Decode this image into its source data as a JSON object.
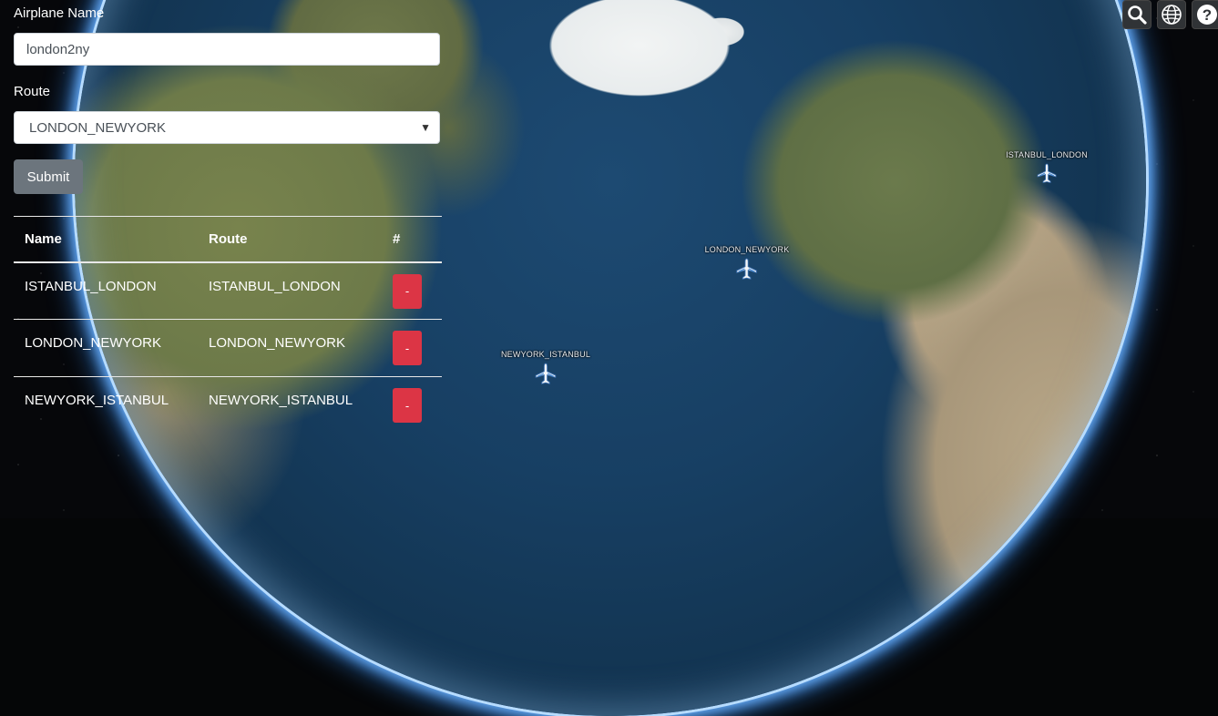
{
  "form": {
    "name_label": "Airplane Name",
    "name_value": "london2ny",
    "route_label": "Route",
    "route_selected": "LONDON_NEWYORK",
    "submit_label": "Submit"
  },
  "table": {
    "headers": [
      "Name",
      "Route",
      "#"
    ],
    "rows": [
      {
        "name": "ISTANBUL_LONDON",
        "route": "ISTANBUL_LONDON",
        "action": "-"
      },
      {
        "name": "LONDON_NEWYORK",
        "route": "LONDON_NEWYORK",
        "action": "-"
      },
      {
        "name": "NEWYORK_ISTANBUL",
        "route": "NEWYORK_ISTANBUL",
        "action": "-"
      }
    ]
  },
  "map": {
    "markers": [
      {
        "label": "ISTANBUL_LONDON",
        "icon": "airplane-icon"
      },
      {
        "label": "LONDON_NEWYORK",
        "icon": "airplane-icon"
      },
      {
        "label": "NEWYORK_ISTANBUL",
        "icon": "airplane-icon"
      }
    ]
  },
  "toolbar": {
    "items": [
      {
        "icon": "search-icon"
      },
      {
        "icon": "globe-icon"
      },
      {
        "icon": "help-icon",
        "glyph": "?"
      }
    ]
  },
  "colors": {
    "danger": "#dc3545",
    "secondary": "#6c757d"
  }
}
